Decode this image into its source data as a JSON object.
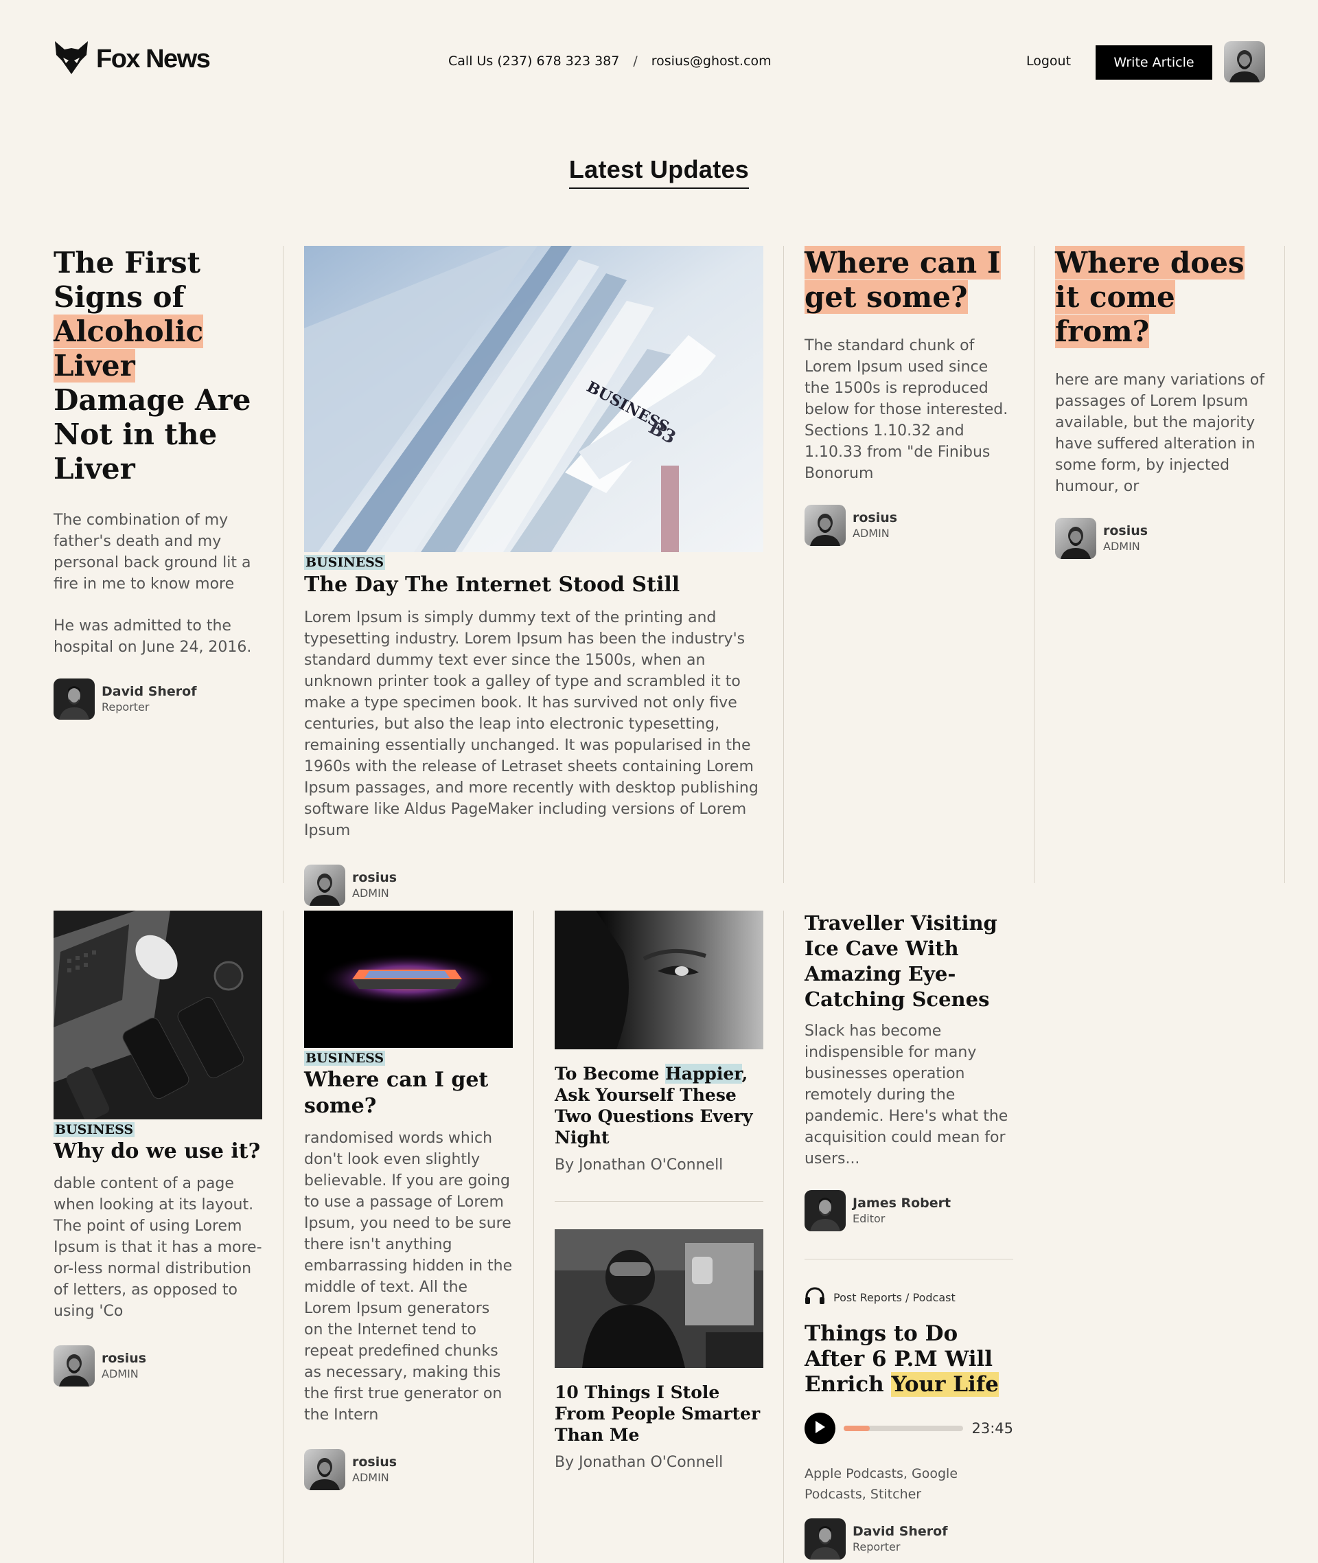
{
  "brand": {
    "name": "Fox News"
  },
  "header": {
    "call_label": "Call Us (237) 678 323 387",
    "separator": "/",
    "email": "rosius@ghost.com",
    "logout": "Logout",
    "write_button": "Write Article"
  },
  "section": {
    "title": "Latest Updates"
  },
  "row1": {
    "feature": {
      "title_parts": [
        "The First Signs of ",
        "Alcoholic Liver",
        " Damage Are Not in the Liver"
      ],
      "para1": "The combination of my father's death and my personal back ground lit a fire in me to know more",
      "para2": "He was admitted to the hospital on June 24, 2016.",
      "author": {
        "name": "David Sherof",
        "role": "Reporter"
      }
    },
    "main": {
      "image": "newspaper-stack-image",
      "category": "BUSINESS",
      "title": "The Day The Internet Stood Still",
      "body": "Lorem Ipsum is simply dummy text of the printing and typesetting industry. Lorem Ipsum has been the industry's standard dummy text ever since the 1500s, when an unknown printer took a galley of type and scrambled it to make a type specimen book. It has survived not only five centuries, but also the leap into electronic typesetting, remaining essentially unchanged. It was popularised in the 1960s with the release of Letraset sheets containing Lorem Ipsum passages, and more recently with desktop publishing software like Aldus PageMaker including versions of Lorem Ipsum",
      "author": {
        "name": "rosius",
        "role": "ADMIN"
      }
    },
    "side1": {
      "title": "Where can I get some?",
      "body": "The standard chunk of Lorem Ipsum used since the 1500s is reproduced below for those interested. Sections 1.10.32 and 1.10.33 from \"de Finibus Bonorum",
      "author": {
        "name": "rosius",
        "role": "ADMIN"
      }
    },
    "side2": {
      "title": "Where does it come from?",
      "body": "here are many variations of passages of Lorem Ipsum available, but the majority have suffered alteration in some form, by injected humour, or",
      "author": {
        "name": "rosius",
        "role": "ADMIN"
      }
    }
  },
  "row2": {
    "card1": {
      "image": "laptop-phones-image",
      "category": "BUSINESS",
      "title": "Why do we use it?",
      "body": "dable content of a page when looking at its layout. The point of using Lorem Ipsum is that it has a more-or-less normal distribution of letters, as opposed to using 'Co",
      "author": {
        "name": "rosius",
        "role": "ADMIN"
      }
    },
    "card2": {
      "image": "glowing-laptop-image",
      "category": "BUSINESS",
      "title": "Where can I get some?",
      "body": "randomised words which don't look even slightly believable. If you are going to use a passage of Lorem Ipsum, you need to be sure there isn't anything embarrassing hidden in the middle of text. All the Lorem Ipsum generators on the Internet tend to repeat predefined chunks as necessary, making this the first true generator on the Intern",
      "author": {
        "name": "rosius",
        "role": "ADMIN"
      }
    },
    "card3": {
      "story1": {
        "image": "face-closeup-image",
        "title_parts": [
          "To Become ",
          "Happier",
          ", Ask Yourself These Two Questions Every Night"
        ],
        "byline": "By Jonathan O'Connell"
      },
      "story2": {
        "image": "radio-host-image",
        "title": "10 Things I Stole From People Smarter Than Me",
        "byline": "By Jonathan O'Connell"
      }
    },
    "card4": {
      "title": "Traveller Visiting Ice Cave With Amazing Eye-Catching Scenes",
      "body": "Slack has become indispensible for many businesses operation remotely during the pandemic. Here's what the acquisition could mean for users...",
      "author": {
        "name": "James Robert",
        "role": "Editor"
      },
      "podcast": {
        "tag": "Post Reports / Podcast",
        "icon": "headphones-icon",
        "title_parts": [
          "Things to Do After 6 P.M Will Enrich ",
          "Your Life"
        ],
        "progress": 0.22,
        "duration": "23:45",
        "platforms": "Apple Podcasts, Google Podcasts, Stitcher",
        "author": {
          "name": "David Sherof",
          "role": "Reporter"
        }
      }
    }
  },
  "colors": {
    "highlight_peach": "#f6b99a",
    "highlight_blue": "#c6dfe1",
    "highlight_yellow": "#f6dc7a",
    "progress": "#f29a78",
    "background": "#f7f3ec"
  }
}
